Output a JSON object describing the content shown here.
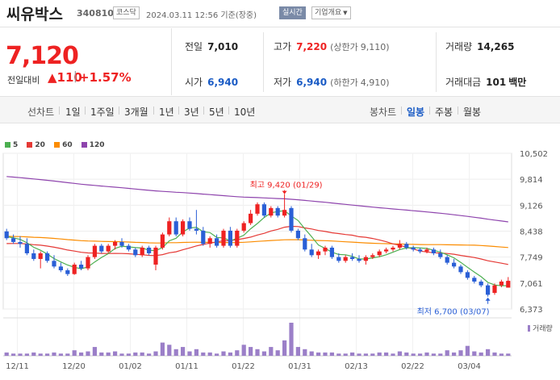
{
  "header": {
    "name": "씨유박스",
    "code": "340810",
    "market": "코스닥",
    "datetime": "2024.03.11 12:56 기준(장중)",
    "realtime": "실시간",
    "company_info": "기업개요"
  },
  "price": {
    "current": "7,120",
    "change_label": "전일대비",
    "change_value": "110",
    "change_pct": "+1.57%"
  },
  "stats": {
    "prev_label": "전일",
    "prev": "7,010",
    "high_label": "고가",
    "high": "7,220",
    "upper_label": "(상한가",
    "upper": "9,110)",
    "volume_label": "거래량",
    "volume": "14,265",
    "open_label": "시가",
    "open": "6,940",
    "low_label": "저가",
    "low": "6,940",
    "lower_label": "(하한가",
    "lower": "4,910)",
    "amount_label": "거래대금",
    "amount": "101",
    "amount_unit": "백만"
  },
  "tabs": {
    "line_label": "선차트",
    "periods": [
      "1일",
      "1주일",
      "3개월",
      "1년",
      "3년",
      "5년",
      "10년"
    ],
    "candle_label": "봉차트",
    "candle": [
      "일봉",
      "주봉",
      "월봉"
    ],
    "selected_candle": "일봉"
  },
  "chart_data": {
    "type": "candlestick",
    "legend": [
      {
        "name": "5",
        "color": "#4caf50"
      },
      {
        "name": "20",
        "color": "#e53935"
      },
      {
        "name": "60",
        "color": "#fb8c00"
      },
      {
        "name": "120",
        "color": "#8e44ad"
      }
    ],
    "y_ticks": [
      "10,502",
      "9,814",
      "9,126",
      "8,438",
      "7,749",
      "7,061",
      "6,373"
    ],
    "ylim": [
      6373,
      10502
    ],
    "x_labels": [
      "12/11",
      "12/20",
      "01/02",
      "01/11",
      "01/22",
      "01/31",
      "02/13",
      "02/22",
      "03/04"
    ],
    "annotation_high": "최고 9,420 (01/29)",
    "annotation_low": "최저 6,700 (03/07)",
    "volume_label": "거래량",
    "candles": [
      [
        8430,
        8500,
        8200,
        8250
      ],
      [
        8250,
        8350,
        8100,
        8150
      ],
      [
        8150,
        8300,
        8000,
        8100
      ],
      [
        8100,
        8250,
        7800,
        7850
      ],
      [
        7850,
        7950,
        7650,
        7700
      ],
      [
        7700,
        7900,
        7450,
        7850
      ],
      [
        7850,
        7900,
        7600,
        7650
      ],
      [
        7650,
        7800,
        7450,
        7500
      ],
      [
        7500,
        7600,
        7350,
        7400
      ],
      [
        7400,
        7450,
        7250,
        7300
      ],
      [
        7300,
        7600,
        7280,
        7550
      ],
      [
        7550,
        7650,
        7400,
        7450
      ],
      [
        7450,
        7800,
        7400,
        7750
      ],
      [
        7750,
        8100,
        7700,
        8050
      ],
      [
        8050,
        8100,
        7850,
        7900
      ],
      [
        7900,
        8100,
        7850,
        8050
      ],
      [
        8050,
        8200,
        7950,
        8150
      ],
      [
        8150,
        8250,
        8000,
        8050
      ],
      [
        8050,
        8100,
        7900,
        7950
      ],
      [
        7950,
        8000,
        7750,
        7800
      ],
      [
        7800,
        8050,
        7750,
        8000
      ],
      [
        8000,
        8050,
        7800,
        7850
      ],
      [
        7550,
        8050,
        7400,
        8000
      ],
      [
        8000,
        8400,
        7950,
        8350
      ],
      [
        8350,
        8800,
        8300,
        8700
      ],
      [
        8700,
        8800,
        8300,
        8350
      ],
      [
        8350,
        8750,
        8300,
        8700
      ],
      [
        8700,
        8800,
        8450,
        8500
      ],
      [
        8500,
        9000,
        8350,
        8450
      ],
      [
        8450,
        8550,
        8050,
        8100
      ],
      [
        8100,
        8300,
        8000,
        8250
      ],
      [
        8250,
        8350,
        8000,
        8050
      ],
      [
        8050,
        8500,
        8000,
        8450
      ],
      [
        8450,
        8550,
        8000,
        8050
      ],
      [
        8050,
        8500,
        8000,
        8450
      ],
      [
        8450,
        8700,
        8400,
        8650
      ],
      [
        8650,
        9000,
        8600,
        8900
      ],
      [
        8900,
        9200,
        8850,
        9150
      ],
      [
        9150,
        9200,
        8800,
        8850
      ],
      [
        8850,
        9100,
        8800,
        9050
      ],
      [
        9050,
        9100,
        8800,
        8850
      ],
      [
        8850,
        9420,
        8800,
        9000
      ],
      [
        9050,
        9100,
        8400,
        8450
      ],
      [
        8450,
        8500,
        8200,
        8250
      ],
      [
        8250,
        8350,
        7900,
        7950
      ],
      [
        7950,
        8100,
        7750,
        7800
      ],
      [
        7800,
        7950,
        7700,
        7900
      ],
      [
        7900,
        8050,
        7800,
        8000
      ],
      [
        8000,
        8050,
        7700,
        7750
      ],
      [
        7750,
        7850,
        7600,
        7650
      ],
      [
        7650,
        7800,
        7600,
        7750
      ],
      [
        7750,
        7850,
        7650,
        7700
      ],
      [
        7700,
        7800,
        7600,
        7650
      ],
      [
        7650,
        7800,
        7550,
        7750
      ],
      [
        7750,
        7850,
        7700,
        7800
      ],
      [
        7800,
        7950,
        7750,
        7900
      ],
      [
        7900,
        8000,
        7850,
        7950
      ],
      [
        7950,
        8050,
        7900,
        8000
      ],
      [
        8000,
        8200,
        7950,
        8100
      ],
      [
        8100,
        8150,
        7950,
        8000
      ],
      [
        8000,
        8050,
        7900,
        7950
      ],
      [
        7950,
        8000,
        7850,
        7900
      ],
      [
        7900,
        8000,
        7850,
        7950
      ],
      [
        7950,
        8000,
        7800,
        7850
      ],
      [
        7850,
        7950,
        7700,
        7750
      ],
      [
        7750,
        7800,
        7550,
        7600
      ],
      [
        7600,
        7700,
        7450,
        7500
      ],
      [
        7500,
        7550,
        7300,
        7350
      ],
      [
        7350,
        7400,
        7150,
        7200
      ],
      [
        7200,
        7250,
        7050,
        7100
      ],
      [
        7100,
        7150,
        6950,
        7000
      ],
      [
        7000,
        7050,
        6700,
        6750
      ],
      [
        6800,
        7050,
        6750,
        7000
      ],
      [
        7000,
        7150,
        6950,
        7100
      ],
      [
        6940,
        7220,
        6940,
        7120
      ]
    ],
    "volumes": [
      3,
      2,
      2,
      2,
      3,
      2,
      2,
      3,
      2,
      2,
      5,
      3,
      4,
      8,
      3,
      3,
      4,
      2,
      2,
      3,
      3,
      2,
      4,
      12,
      10,
      6,
      8,
      4,
      6,
      3,
      3,
      2,
      4,
      3,
      5,
      10,
      8,
      6,
      4,
      8,
      5,
      14,
      30,
      8,
      6,
      4,
      3,
      3,
      3,
      2,
      2,
      3,
      2,
      2,
      2,
      3,
      3,
      2,
      4,
      3,
      2,
      2,
      3,
      2,
      2,
      5,
      3,
      5,
      9,
      4,
      3,
      6,
      3,
      2,
      2
    ]
  }
}
